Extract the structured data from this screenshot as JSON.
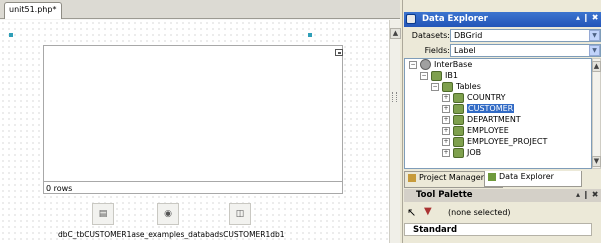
{
  "editor": {
    "tab_label": "unit51.php*",
    "tab_controls": "♡ ☒",
    "grid_status": "0 rows",
    "component_icons": [
      "db-grid-icon",
      "database-icon",
      "datasource-icon"
    ],
    "component_caption": "dbC_tbCUSTOMER1ase_examples_databadsCUSTOMER1db1"
  },
  "data_explorer": {
    "title": "Data Explorer",
    "title_controls": "▴ ❙ ✖",
    "datasets_label": "Datasets:",
    "datasets_value": "DBGrid",
    "fields_label": "Fields:",
    "fields_value": "Label",
    "tree": [
      {
        "label": "InterBase",
        "level": 0,
        "expander": "minus",
        "icon": "server-icon"
      },
      {
        "label": "IB1",
        "level": 1,
        "expander": "minus",
        "icon": "database-icon"
      },
      {
        "label": "Tables",
        "level": 2,
        "expander": "minus",
        "icon": "folder-icon"
      },
      {
        "label": "COUNTRY",
        "level": 3,
        "expander": "plus",
        "icon": "table-icon"
      },
      {
        "label": "CUSTOMER",
        "level": 3,
        "expander": "plus",
        "icon": "table-icon",
        "selected": true
      },
      {
        "label": "DEPARTMENT",
        "level": 3,
        "expander": "plus",
        "icon": "table-icon"
      },
      {
        "label": "EMPLOYEE",
        "level": 3,
        "expander": "plus",
        "icon": "table-icon"
      },
      {
        "label": "EMPLOYEE_PROJECT",
        "level": 3,
        "expander": "plus",
        "icon": "table-icon"
      },
      {
        "label": "JOB",
        "level": 3,
        "expander": "plus",
        "icon": "table-icon"
      }
    ],
    "bottom_tabs": [
      "Project Manager",
      "Data Explorer"
    ]
  },
  "tool_palette": {
    "title": "Tool Palette",
    "title_controls": "▴ ❙ ✖",
    "selection_text": "(none selected)",
    "category": "Standard"
  },
  "colors": {
    "accent": "#316ac5",
    "title_bar": "#2355b8",
    "designer_handle": "#2f9fb8"
  }
}
